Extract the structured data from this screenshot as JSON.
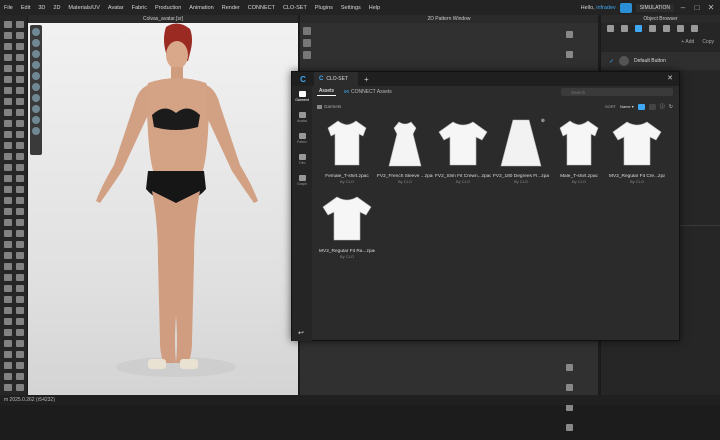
{
  "menubar": {
    "items": [
      "File",
      "Edit",
      "3D",
      "2D",
      "Materials/UV",
      "Avatar",
      "Fabric",
      "Production",
      "Animation",
      "Render",
      "CONNECT",
      "CLO-SET",
      "Plugins",
      "Settings",
      "Help"
    ],
    "user_greeting": "Hello, ",
    "user_name": "infradev",
    "simulation_label": "SIMULATION"
  },
  "viewport": {
    "title": "Colvas_avatar.[sr]"
  },
  "pattern_window": {
    "title": "2D Pattern Window"
  },
  "object_browser": {
    "title": "Object Browser",
    "add_label": "Add",
    "copy_label": "Copy",
    "default_button_label": "Default Button",
    "filter_label": "ilter"
  },
  "status_bar": {
    "text": "m 2025.0.262 (r54232)"
  },
  "dialog": {
    "tab_title": "CLO-SET",
    "side_items": [
      {
        "label": "Garment",
        "icon": "shirt-icon"
      },
      {
        "label": "Avatar",
        "icon": "avatar-icon"
      },
      {
        "label": "Fabric",
        "icon": "fabric-icon"
      },
      {
        "label": "Trim",
        "icon": "trim-icon"
      },
      {
        "label": "Graph",
        "icon": "graph-icon"
      }
    ],
    "sub_tabs": [
      "Assets",
      "CONNECT Assets"
    ],
    "search_placeholder": "Search",
    "breadcrumb": "Garmets",
    "sort_label": "SORT",
    "sort_value": "Name",
    "items": [
      {
        "name": "Female_T-shirt.zpac",
        "by": "By CLO",
        "shape": "tshirt"
      },
      {
        "name": "FV2_French Sleeve ...zpac",
        "by": "By CLO",
        "shape": "dress"
      },
      {
        "name": "FV2_Slim Fit Crewn...zpac",
        "by": "By CLO",
        "shape": "tshirt2"
      },
      {
        "name": "FV2_180 Degrees Fl...zpac",
        "by": "By CLO",
        "shape": "skirt"
      },
      {
        "name": "Male_T-shirt.zpac",
        "by": "By CLO",
        "shape": "tshirt"
      },
      {
        "name": "MV2_Regular Fit Cre...zpac",
        "by": "By CLO",
        "shape": "tshirt2"
      },
      {
        "name": "MV2_Regular Fit Ra...zpac",
        "by": "By CLO",
        "shape": "tshirt2"
      }
    ]
  }
}
